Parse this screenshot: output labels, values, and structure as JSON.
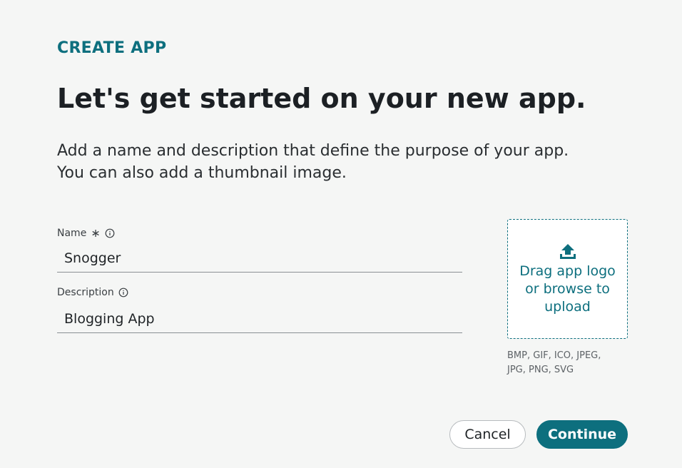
{
  "header": {
    "eyebrow": "CREATE APP",
    "title": "Let's get started on your new app.",
    "intro_line1": "Add a name and description that define the purpose of your app.",
    "intro_line2": "You can also add a thumbnail image."
  },
  "form": {
    "name": {
      "label": "Name",
      "required_marker": "∗",
      "value": "Snogger",
      "info_icon": "info-circle-icon"
    },
    "description": {
      "label": "Description",
      "value": "Blogging App",
      "info_icon": "info-circle-icon"
    }
  },
  "upload": {
    "icon": "upload-icon",
    "line1": "Drag app logo",
    "line2": "or browse to",
    "line3": "upload",
    "formats_line1": "BMP, GIF, ICO, JPEG,",
    "formats_line2": "JPG, PNG, SVG"
  },
  "actions": {
    "cancel_label": "Cancel",
    "continue_label": "Continue"
  },
  "colors": {
    "accent": "#0d6f7e",
    "background": "#f5f6f5"
  }
}
